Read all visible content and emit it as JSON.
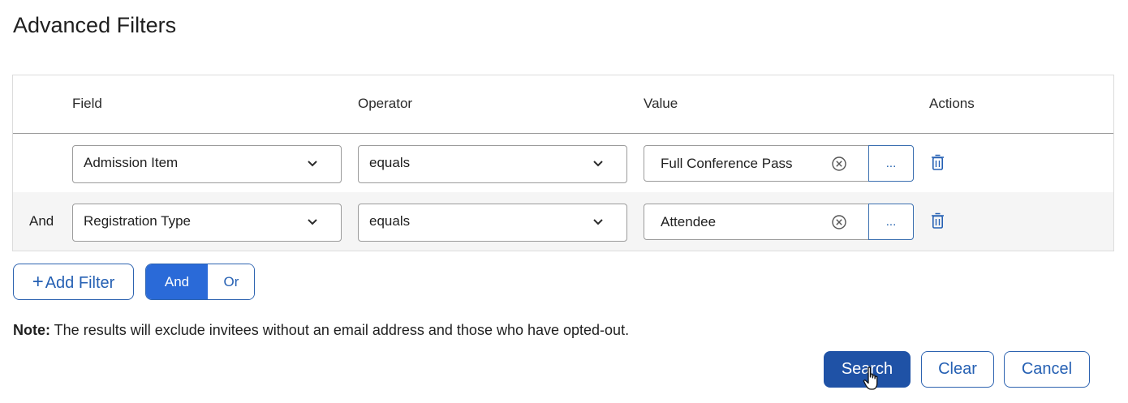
{
  "page": {
    "title": "Advanced Filters"
  },
  "table": {
    "headers": {
      "field": "Field",
      "operator": "Operator",
      "value": "Value",
      "actions": "Actions"
    },
    "rows": [
      {
        "conjunction": "",
        "field": "Admission Item",
        "operator": "equals",
        "value": "Full Conference Pass",
        "ellipsis": "..."
      },
      {
        "conjunction": "And",
        "field": "Registration Type",
        "operator": "equals",
        "value": "Attendee",
        "ellipsis": "..."
      }
    ]
  },
  "controls": {
    "add_filter": {
      "plus": "+",
      "label": "Add Filter"
    },
    "logic_toggle": {
      "and": "And",
      "or": "Or",
      "selected": "And"
    }
  },
  "note": {
    "label": "Note:",
    "text": " The results will exclude invitees without an email address and those who have opted-out."
  },
  "actions": {
    "search": "Search",
    "clear": "Clear",
    "cancel": "Cancel"
  },
  "colors": {
    "primary": "#1f52a6",
    "toggle_active": "#2a6ad8",
    "accent_text": "#2560b3"
  },
  "icons": {
    "select_arrow": "chevron-down-icon",
    "clear": "clear-circle-icon",
    "delete": "trash-icon",
    "cursor": "hand-pointer-cursor-icon"
  }
}
